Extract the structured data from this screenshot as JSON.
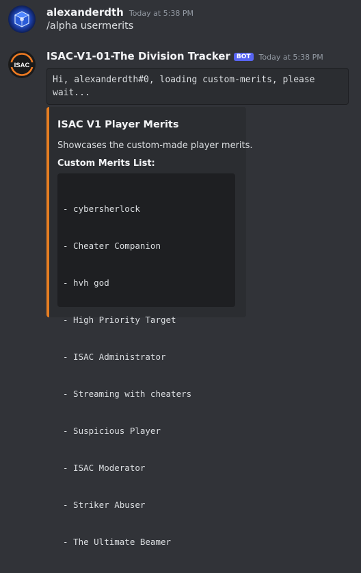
{
  "colors": {
    "background": "#313338",
    "embed_accent": "#e67e22",
    "bot_badge": "#5865f2"
  },
  "messages": [
    {
      "avatar_icon": "blue-cube-avatar-icon",
      "username": "alexanderdth",
      "timestamp": "Today at 5:38 PM",
      "content": "/alpha usermerits"
    },
    {
      "avatar_icon": "isac-logo-avatar-icon",
      "avatar_text": "ISAC",
      "username": "ISAC-V1-01-The Division Tracker",
      "badge": "BOT",
      "timestamp": "Today at 5:38 PM",
      "code_content": "Hi, alexanderdth#0, loading custom-merits, please wait...",
      "embed": {
        "title": "ISAC V1 Player Merits",
        "description": "Showcases the custom-made player merits.",
        "field_name": "Custom Merits List:",
        "merits": [
          "- cybersherlock",
          "- Cheater Companion",
          "- hvh god",
          "- High Priority Target",
          "- ISAC Administrator",
          "- Streaming with cheaters",
          "- Suspicious Player",
          "- ISAC Moderator",
          "- Striker Abuser",
          "- The Ultimate Beamer"
        ]
      }
    }
  ]
}
